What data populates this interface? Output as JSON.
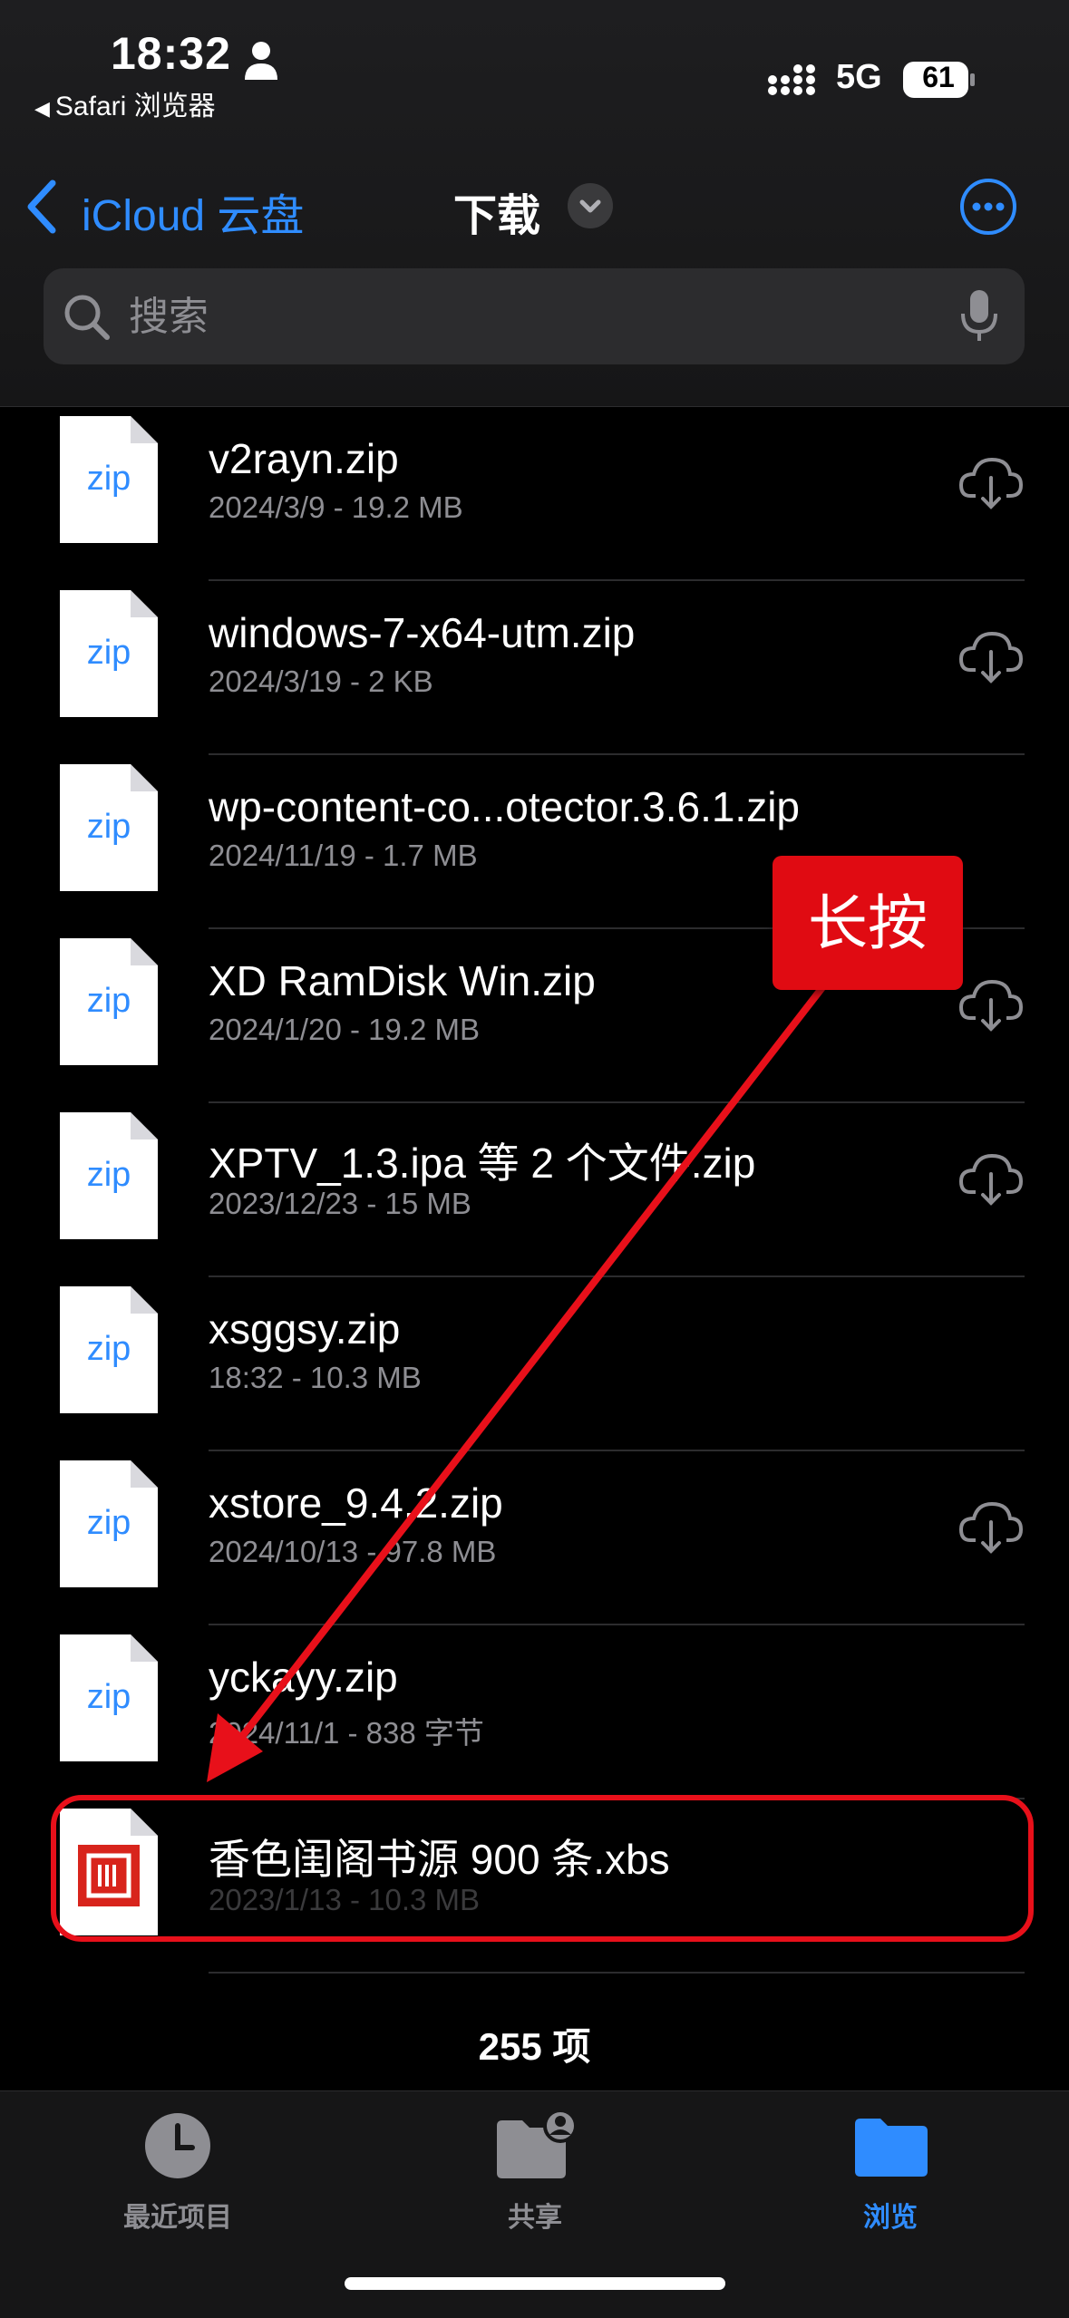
{
  "status_bar": {
    "time": "18:32",
    "back_app": "Safari 浏览器",
    "network": "5G",
    "battery": "61"
  },
  "nav": {
    "back_label": "iCloud 云盘",
    "title": "下载"
  },
  "search": {
    "placeholder": "搜索"
  },
  "files": [
    {
      "thumb": "zip",
      "name": "v2rayn.zip",
      "meta": "2024/3/9 - 19.2 MB",
      "cloud": true
    },
    {
      "thumb": "zip",
      "name": "windows-7-x64-utm.zip",
      "meta": "2024/3/19 - 2 KB",
      "cloud": true
    },
    {
      "thumb": "zip",
      "name": "wp-content-co...otector.3.6.1.zip",
      "meta": "2024/11/19 - 1.7 MB",
      "cloud": false
    },
    {
      "thumb": "zip",
      "name": "XD RamDisk Win.zip",
      "meta": "2024/1/20 - 19.2 MB",
      "cloud": true
    },
    {
      "thumb": "zip",
      "name": "XPTV_1.3.ipa 等 2 个文件.zip",
      "meta": "2023/12/23 - 15 MB",
      "cloud": true
    },
    {
      "thumb": "zip",
      "name": "xsggsy.zip",
      "meta": "18:32 - 10.3 MB",
      "cloud": false
    },
    {
      "thumb": "zip",
      "name": "xstore_9.4.2.zip",
      "meta": "2024/10/13 - 97.8 MB",
      "cloud": true
    },
    {
      "thumb": "zip",
      "name": "yckayy.zip",
      "meta": "2024/11/1 - 838 字节",
      "cloud": false
    },
    {
      "thumb": "xbs",
      "name": "香色闺阁书源 900 条.xbs",
      "meta": "2023/1/13 - 10.3 MB",
      "cloud": false
    }
  ],
  "item_count": "255 项",
  "annotation": {
    "callout": "长按"
  },
  "tabs": [
    {
      "label": "最近项目",
      "icon": "clock-icon",
      "active": false
    },
    {
      "label": "共享",
      "icon": "shared-folder-icon",
      "active": false
    },
    {
      "label": "浏览",
      "icon": "folder-icon",
      "active": true
    }
  ],
  "colors": {
    "accent": "#2f8cff",
    "annotation_red": "#e8101a",
    "secondary_text": "#8e8e93"
  }
}
